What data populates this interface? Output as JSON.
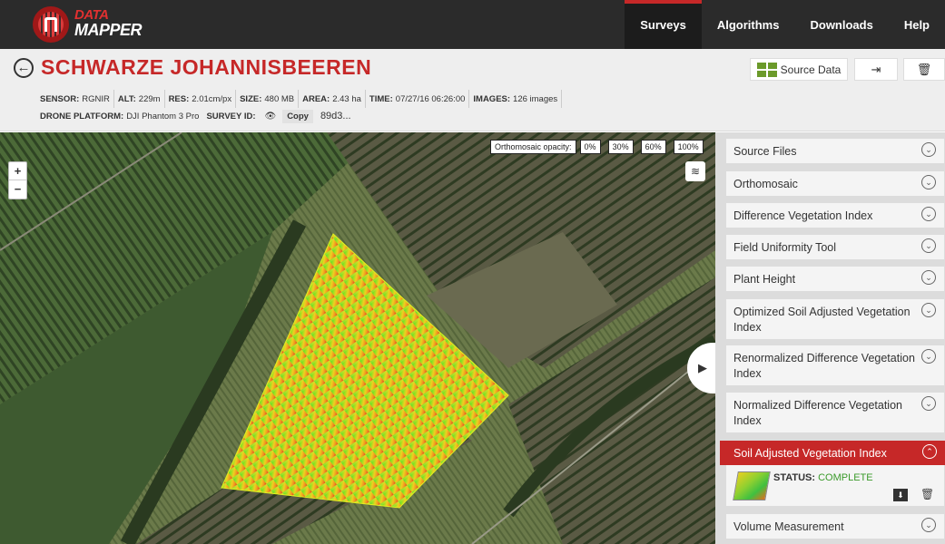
{
  "nav": {
    "logo_line1": "DATA",
    "logo_line2": "MAPPER",
    "items": [
      "Surveys",
      "Algorithms",
      "Downloads",
      "Help"
    ]
  },
  "header": {
    "back_icon": "arrow-left-circle-icon",
    "title": "SCHWARZE JOHANNISBEEREN",
    "meta": {
      "sensor_label": "SENSOR:",
      "sensor": "RGNIR",
      "alt_label": "ALT:",
      "alt": "229m",
      "res_label": "RES:",
      "res": "2.01cm/px",
      "size_label": "SIZE:",
      "size": "480 MB",
      "area_label": "AREA:",
      "area": "2.43 ha",
      "time_label": "TIME:",
      "time": "07/27/16 06:26:00",
      "images_label": "IMAGES:",
      "images": "126 images",
      "platform_label": "DRONE PLATFORM:",
      "platform": "DJI Phantom 3 Pro",
      "survey_label": "SURVEY ID:",
      "copy_label": "Copy",
      "survey_id": "89d3..."
    },
    "source_button": "Source Data"
  },
  "map": {
    "opacity_label": "Orthomosaic opacity:",
    "opacity_options": [
      "0%",
      "30%",
      "60%",
      "100%"
    ],
    "zoom_in": "+",
    "zoom_out": "−"
  },
  "sidebar": {
    "items": [
      "Source Files",
      "Orthomosaic",
      "Difference Vegetation Index",
      "Field Uniformity Tool",
      "Plant Height",
      "Optimized Soil Adjusted Vegetation Index",
      "Renormalized Difference Vegetation Index",
      "Normalized Difference Vegetation Index",
      "Soil Adjusted Vegetation Index",
      "Volume Measurement"
    ],
    "active_item": "Soil Adjusted Vegetation Index",
    "status_label": "STATUS:",
    "status_value": "COMPLETE"
  },
  "colors": {
    "accent": "#c62828",
    "topbar": "#2b2b2b",
    "status_ok": "#3a9a2a"
  }
}
